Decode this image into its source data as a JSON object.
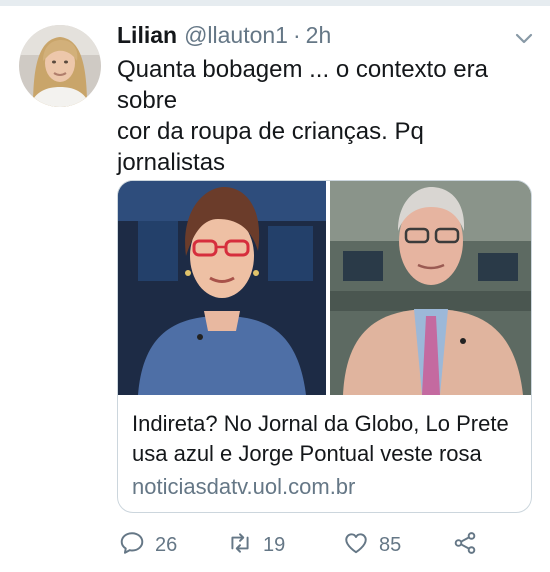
{
  "tweet": {
    "author_name": "Lilian",
    "handle": "@llauton1",
    "separator": "·",
    "time": "2h",
    "text": "Quanta bobagem ... o contexto era sobre\ncor da roupa de crianças. Pq jornalistas\nde tão alto gabarito se apequenam\nassim?"
  },
  "card": {
    "title": "Indireta? No Jornal da Globo, Lo Prete\nusa azul e Jorge Pontual veste rosa",
    "domain": "noticiasdatv.uol.com.br"
  },
  "actions": {
    "replies": "26",
    "retweets": "19",
    "likes": "85"
  },
  "colors": {
    "text": "#14171a",
    "secondary": "#657786",
    "border": "#ccd6dd"
  },
  "icons": [
    "chevron-down-icon",
    "reply-icon",
    "retweet-icon",
    "like-icon",
    "share-icon"
  ]
}
